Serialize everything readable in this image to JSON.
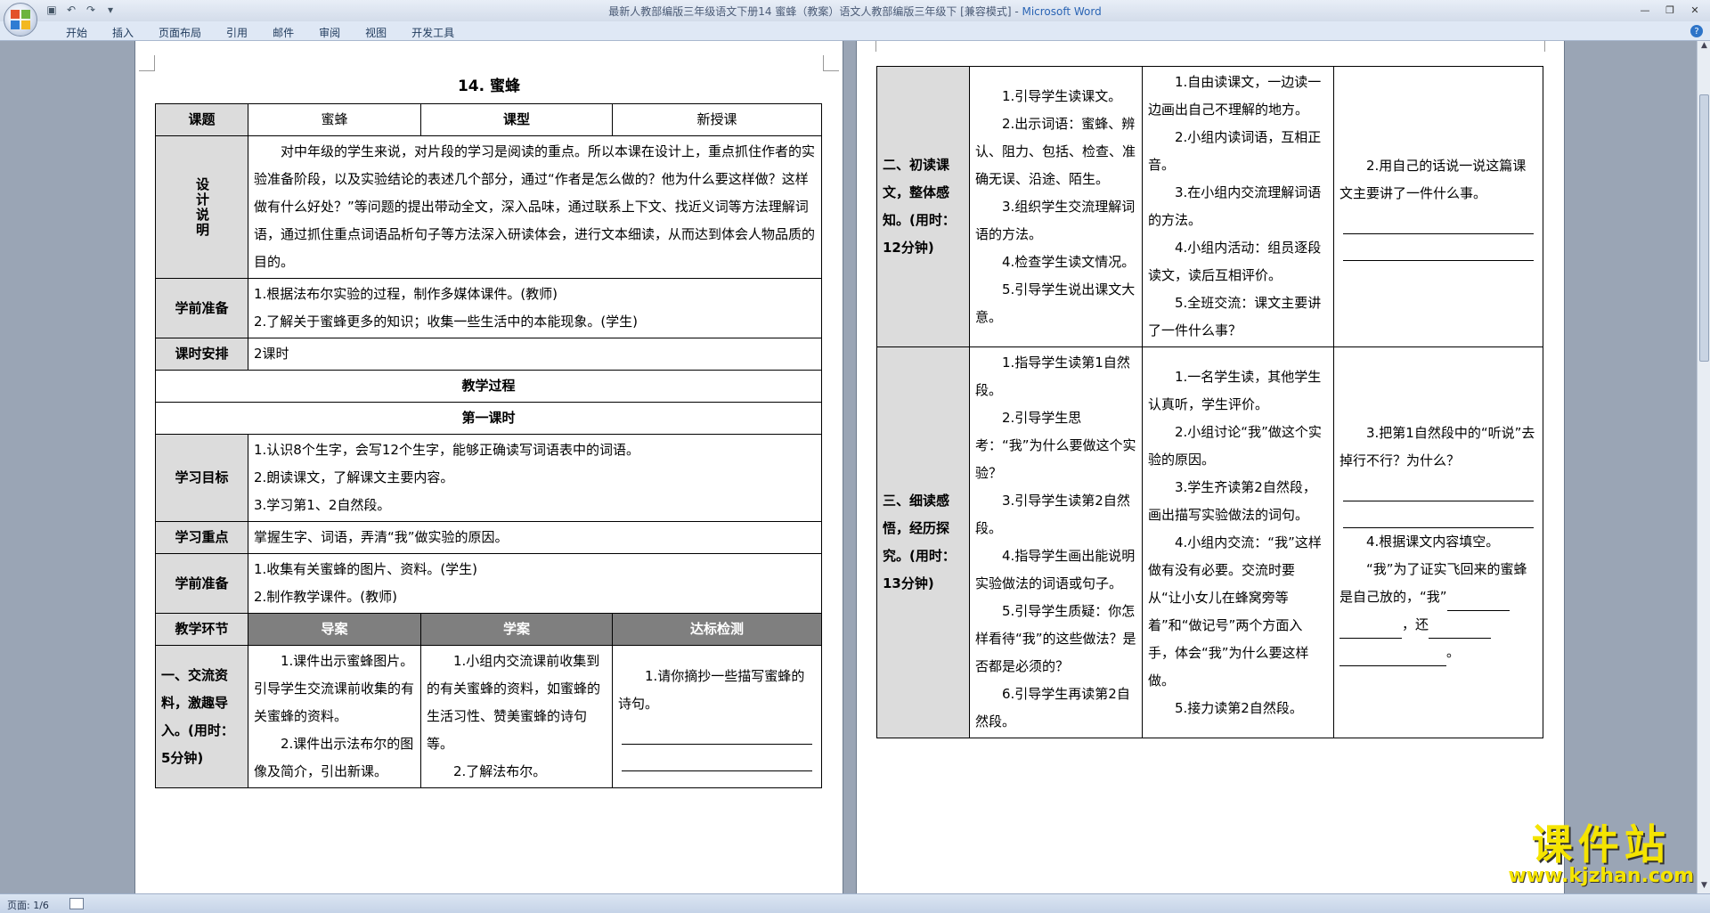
{
  "window": {
    "title": "最新人教部编版三年级语文下册14 蜜蜂（教案）语文人教部编版三年级下 [兼容模式] - ",
    "app_name": "Microsoft Word",
    "tabs": [
      "开始",
      "插入",
      "页面布局",
      "引用",
      "邮件",
      "审阅",
      "视图",
      "开发工具"
    ]
  },
  "status": {
    "page": "页面: 1/6"
  },
  "doc": {
    "title": "14. 蜜蜂",
    "labels": {
      "topic": "课题",
      "topic_value": "蜜蜂",
      "type": "课型",
      "type_value": "新授课",
      "design": "设计说明",
      "prep": "学前准备",
      "schedule": "课时安排",
      "schedule_value": "2课时",
      "process": "教学过程",
      "first_lesson": "第一课时",
      "goal": "学习目标",
      "focus": "学习重点",
      "prep2": "学前准备",
      "step": "教学环节",
      "guide": "导案",
      "study": "学案",
      "check": "达标检测"
    },
    "design_text": "对中年级的学生来说，对片段的学习是阅读的重点。所以本课在设计上，重点抓住作者的实验准备阶段，以及实验结论的表述几个部分，通过“作者是怎么做的？他为什么要这样做？这样做有什么好处？”等问题的提出带动全文，深入品味，通过联系上下文、找近义词等方法理解词语，通过抓住重点词语品析句子等方法深入研读体会，进行文本细读，从而达到体会人物品质的目的。",
    "prep_items": [
      "1.根据法布尔实验的过程，制作多媒体课件。(教师)",
      "2.了解关于蜜蜂更多的知识；收集一些生活中的本能现象。(学生)"
    ],
    "goal_items": [
      "1.认识8个生字，会写12个生字，能够正确读写词语表中的词语。",
      "2.朗读课文，了解课文主要内容。",
      "3.学习第1、2自然段。"
    ],
    "focus_text": "掌握生字、词语，弄清“我”做实验的原因。",
    "prep2_items": [
      "1.收集有关蜜蜂的图片、资料。(学生)",
      "2.制作教学课件。(教师)"
    ],
    "step1": {
      "label": "一、交流资料，激趣导入。(用时：5分钟)",
      "guide": [
        "1.课件出示蜜蜂图片。引导学生交流课前收集的有关蜜蜂的资料。",
        "2.课件出示法布尔的图像及简介，引出新课。"
      ],
      "study": [
        "1.小组内交流课前收集到的有关蜜蜂的资料，如蜜蜂的生活习性、赞美蜜蜂的诗句等。",
        "2.了解法布尔。"
      ],
      "check": "1.请你摘抄一些描写蜜蜂的诗句。"
    },
    "step2": {
      "label": "二、初读课文，整体感知。(用时：12分钟)",
      "guide": [
        "1.引导学生读课文。",
        "2.出示词语：蜜蜂、辨认、阻力、包括、检查、准确无误、沿途、陌生。",
        "3.组织学生交流理解词语的方法。",
        "4.检查学生读文情况。",
        "5.引导学生说出课文大意。"
      ],
      "study": [
        "1.自由读课文，一边读一边画出自己不理解的地方。",
        "2.小组内读词语，互相正音。",
        "3.在小组内交流理解词语的方法。",
        "4.小组内活动：组员逐段读文，读后互相评价。",
        "5.全班交流：课文主要讲了一件什么事？"
      ],
      "check": "2.用自己的话说一说这篇课文主要讲了一件什么事。"
    },
    "step3": {
      "label": "三、细读感悟，经历探究。(用时：13分钟)",
      "guide": [
        "1.指导学生读第1自然段。",
        "2.引导学生思考：“我”为什么要做这个实验？",
        "3.引导学生读第2自然段。",
        "4.指导学生画出能说明实验做法的词语或句子。",
        "5.引导学生质疑：你怎样看待“我”的这些做法？是否都是必须的？",
        "6.引导学生再读第2自然段。"
      ],
      "study": [
        "1.一名学生读，其他学生认真听，学生评价。",
        "2.小组讨论“我”做这个实验的原因。",
        "3.学生齐读第2自然段，画出描写实验做法的词句。",
        "4.小组内交流：“我”这样做有没有必要。交流时要从“让小女儿在蜂窝旁等着”和“做记号”两个方面入手，体会“我”为什么要这样做。",
        "5.接力读第2自然段。"
      ],
      "check_q3": "3.把第1自然段中的“听说”去掉行不行？为什么？",
      "check_q4": "4.根据课文内容填空。",
      "check_fill_a": "“我”为了证实飞回来的蜜蜂是自己放的，“我”",
      "check_fill_b": "，还",
      "check_fill_c": "。"
    }
  },
  "watermark": {
    "big": "课件站",
    "small": "www.kjzhan.com"
  }
}
